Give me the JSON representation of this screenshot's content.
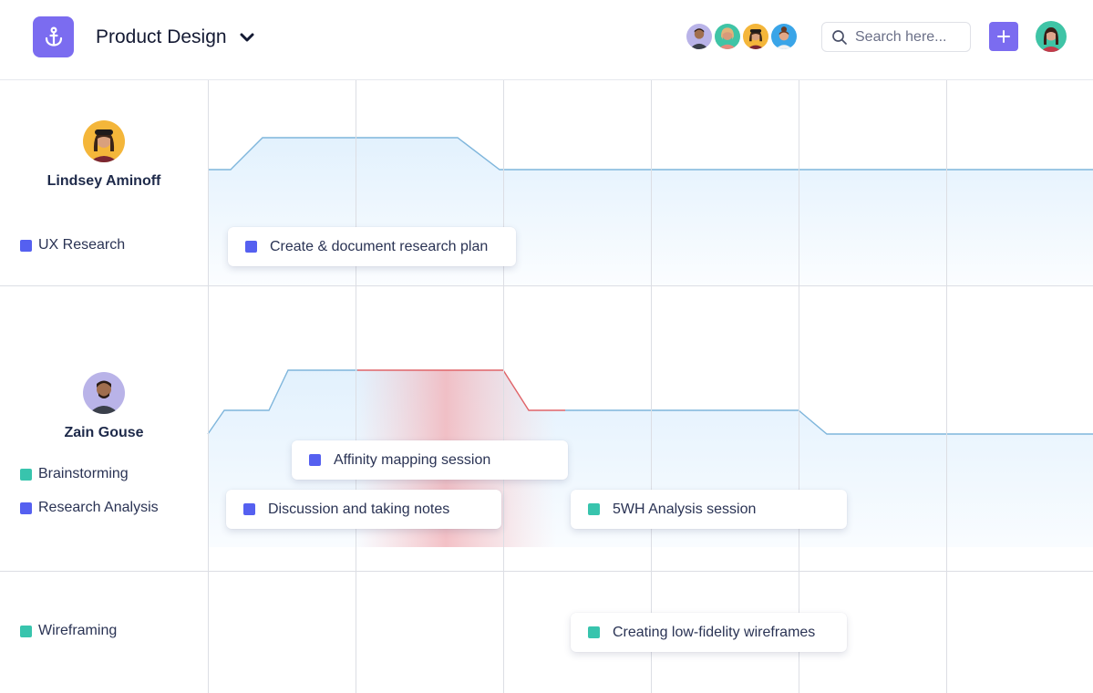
{
  "header": {
    "project_title": "Product Design",
    "search_placeholder": "Search here...",
    "add_label": "+",
    "team_avatars": [
      "team-member-1",
      "team-member-2",
      "team-member-3",
      "team-member-4"
    ]
  },
  "colors": {
    "accent": "#7b6cf0",
    "research_blue": "#5560f0",
    "brainstorm_teal": "#38c4ad",
    "line_blue": "#7fb6dc",
    "overload_red": "#e06469"
  },
  "people": [
    {
      "name": "Lindsey Aminoff",
      "categories": [
        {
          "label": "UX Research",
          "color": "#5560f0"
        }
      ],
      "tasks": [
        {
          "label": "Create & document research plan",
          "color": "#5560f0"
        }
      ]
    },
    {
      "name": "Zain Gouse",
      "categories": [
        {
          "label": "Brainstorming",
          "color": "#38c4ad"
        },
        {
          "label": "Research Analysis",
          "color": "#5560f0"
        }
      ],
      "tasks": [
        {
          "label": "Affinity mapping session",
          "color": "#5560f0"
        },
        {
          "label": "Discussion and taking notes",
          "color": "#5560f0"
        },
        {
          "label": "5WH Analysis session",
          "color": "#38c4ad"
        }
      ]
    },
    {
      "name": "",
      "categories": [
        {
          "label": "Wireframing",
          "color": "#38c4ad"
        }
      ],
      "tasks": [
        {
          "label": "Creating low-fidelity wireframes",
          "color": "#38c4ad"
        }
      ]
    }
  ]
}
